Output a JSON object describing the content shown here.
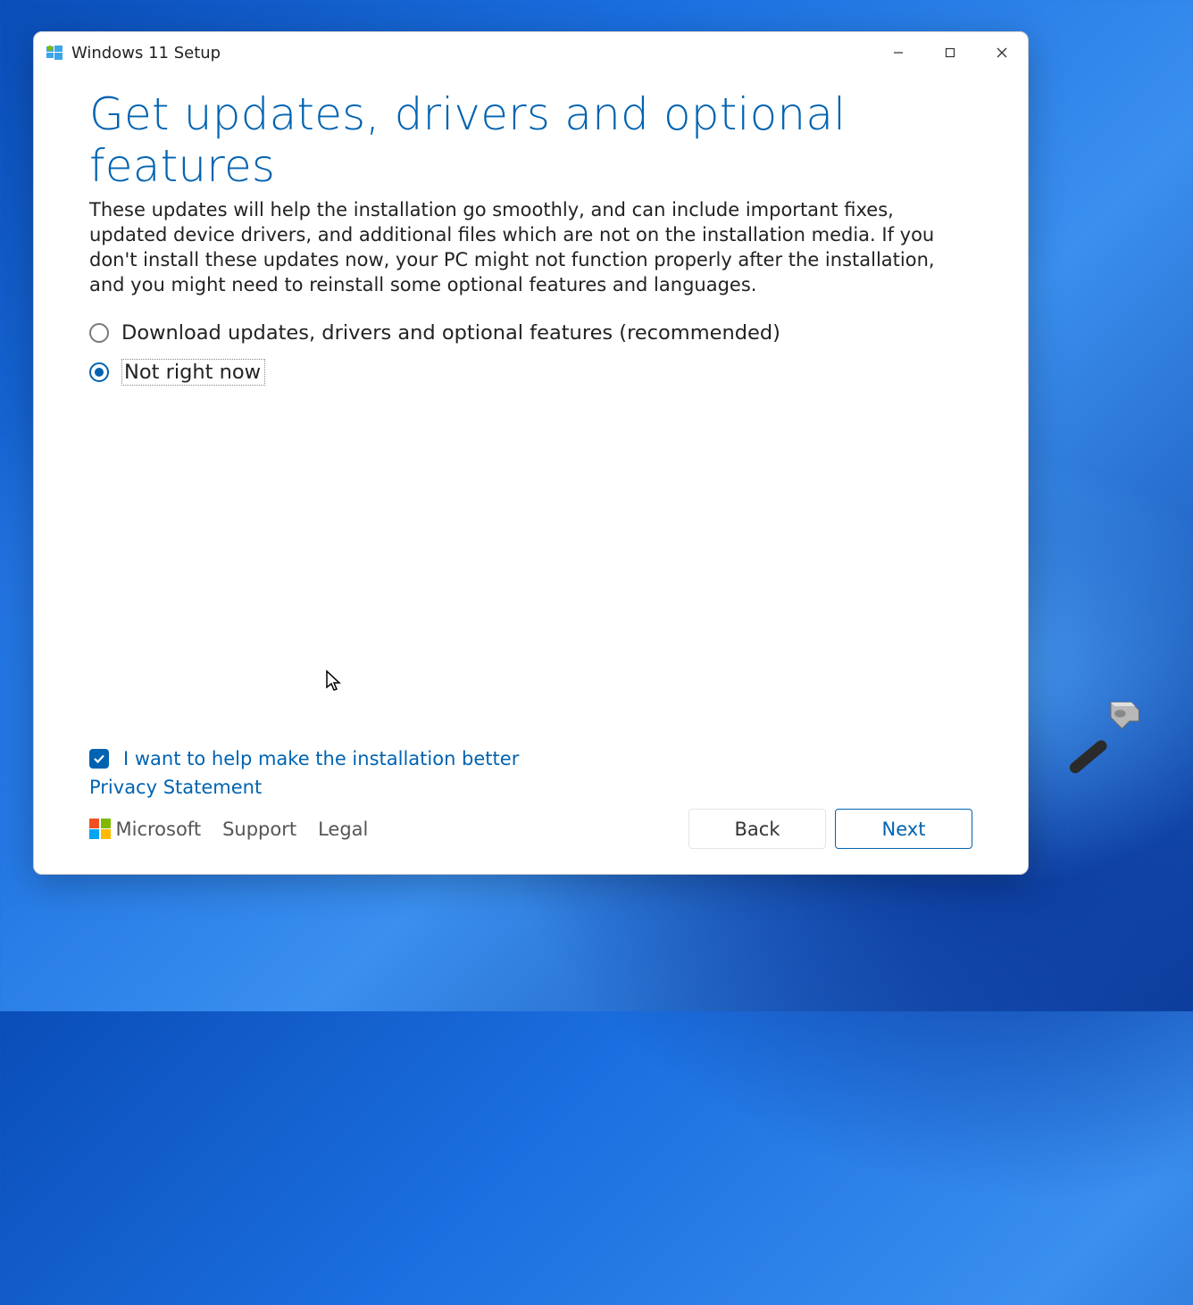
{
  "window": {
    "title": "Windows 11 Setup"
  },
  "page": {
    "heading": "Get updates, drivers and optional features",
    "description": "These updates will help the installation go smoothly, and can include important fixes, updated device drivers, and additional files which are not on the installation media. If you don't install these updates now, your PC might not function properly after the installation, and you might need to reinstall some optional features and languages."
  },
  "options": {
    "download": {
      "label": "Download updates, drivers and optional features (recommended)",
      "selected": false
    },
    "not_now": {
      "label": "Not right now",
      "selected": true
    }
  },
  "help_checkbox": {
    "label": "I want to help make the installation better",
    "checked": true
  },
  "links": {
    "privacy": "Privacy Statement",
    "microsoft": "Microsoft",
    "support": "Support",
    "legal": "Legal"
  },
  "buttons": {
    "back": "Back",
    "next": "Next"
  }
}
